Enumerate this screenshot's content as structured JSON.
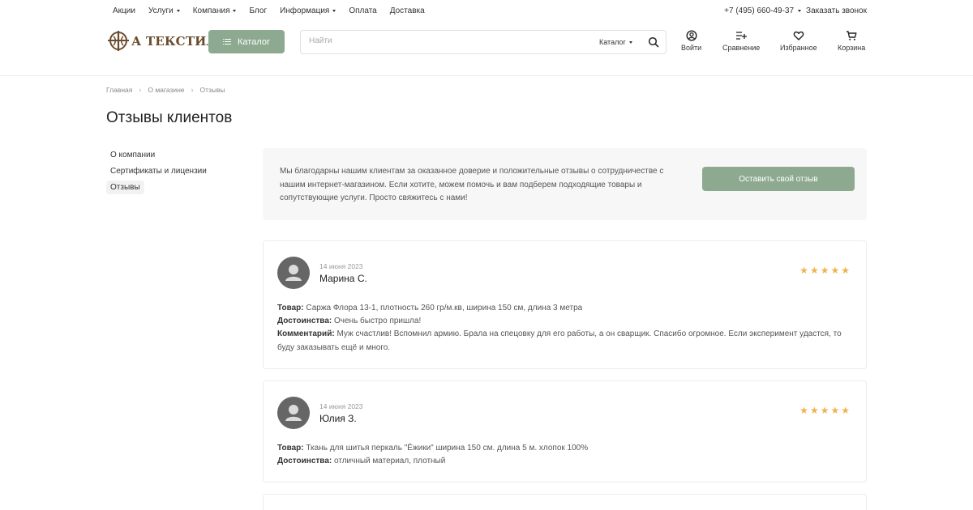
{
  "topbar": {
    "nav": [
      {
        "label": "Акции",
        "dropdown": false
      },
      {
        "label": "Услуги",
        "dropdown": true
      },
      {
        "label": "Компания",
        "dropdown": true
      },
      {
        "label": "Блог",
        "dropdown": false
      },
      {
        "label": "Информация",
        "dropdown": true
      },
      {
        "label": "Оплата",
        "dropdown": false
      },
      {
        "label": "Доставка",
        "dropdown": false
      }
    ],
    "phone": "+7 (495) 660-49-37",
    "callback": "Заказать звонок"
  },
  "header": {
    "logo_text": "А ТЕКСТИЛЬ",
    "catalog_label": "Каталог",
    "search": {
      "placeholder": "Найти",
      "scope_label": "Каталог"
    },
    "icons": [
      {
        "label": "Войти",
        "icon": "user-icon"
      },
      {
        "label": "Сравнение",
        "icon": "compare-icon"
      },
      {
        "label": "Избранное",
        "icon": "heart-icon"
      },
      {
        "label": "Корзина",
        "icon": "cart-icon"
      }
    ]
  },
  "breadcrumb": [
    "Главная",
    "О магазине",
    "Отзывы"
  ],
  "page_title": "Отзывы клиентов",
  "sidebar": {
    "items": [
      {
        "label": "О компании"
      },
      {
        "label": "Сертификаты и лицензии"
      },
      {
        "label": "Отзывы"
      }
    ]
  },
  "intro": {
    "text": "Мы благодарны нашим клиентам за оказанное доверие и положительные отзывы о сотрудничестве с нашим интернет-магазином. Если хотите, можем помочь и вам подберем подходящие товары и сопутствующие услуги. Просто свяжитесь с нами!",
    "button": "Оставить свой отзыв"
  },
  "reviews": [
    {
      "date": "14 июня 2023",
      "name": "Марина С.",
      "rating": 5,
      "product_label": "Товар:",
      "product": "Саржа Флора 13-1, плотность 260 гр/м.кв, ширина 150 см, длина 3 метра",
      "pros_label": "Достоинства:",
      "pros": "Очень быстро пришла!",
      "comment_label": "Комментарий:",
      "comment": "Муж счастлив! Вспомнил армию. Брала на спецовку для его работы, а он сварщик. Спасибо огромное. Если эксперимент удастся, то буду заказывать ещё и много."
    },
    {
      "date": "14 июня 2023",
      "name": "Юлия З.",
      "rating": 5,
      "product_label": "Товар:",
      "product": "Ткань для шитья перкаль \"Ёжики\" ширина 150 см. длина 5 м. хлопок 100%",
      "pros_label": "Достоинства:",
      "pros": "отличный материал, плотный"
    }
  ],
  "colors": {
    "accent": "#8daa91",
    "star": "#f0b24f",
    "logo": "#6b4b2e"
  }
}
